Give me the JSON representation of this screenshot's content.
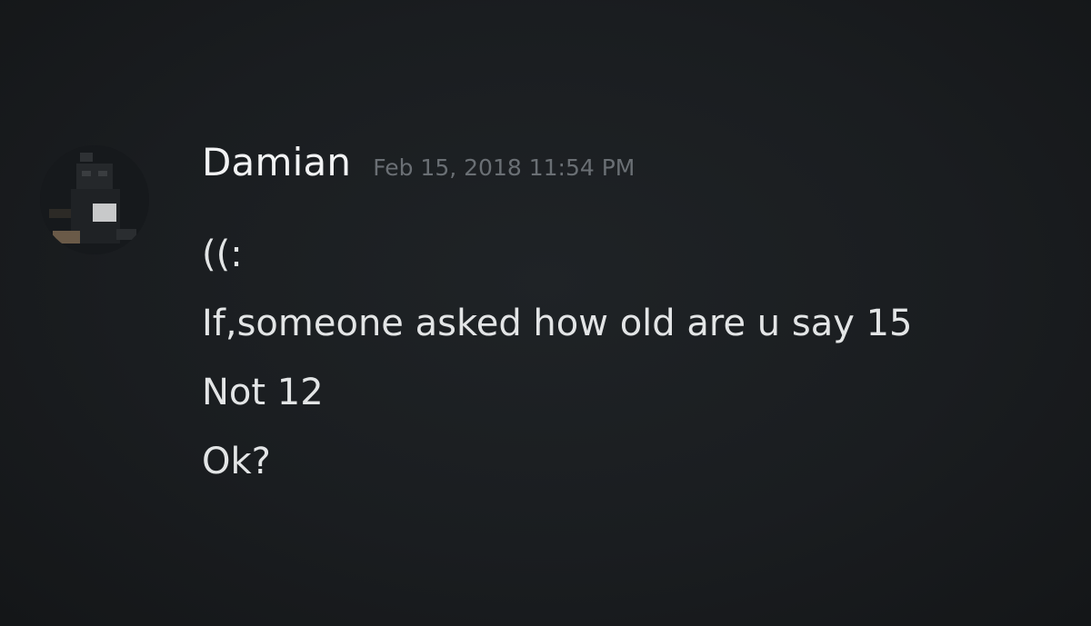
{
  "message": {
    "author": "Damian",
    "timestamp": "Feb 15, 2018 11:54 PM",
    "lines": [
      "((:",
      "If,someone asked how old are u say 15",
      "Not 12",
      "Ok?"
    ]
  },
  "colors": {
    "background": "#1b1e21",
    "username": "#f2f3f4",
    "timestamp": "#6a6f74",
    "text": "#e3e5e6"
  }
}
